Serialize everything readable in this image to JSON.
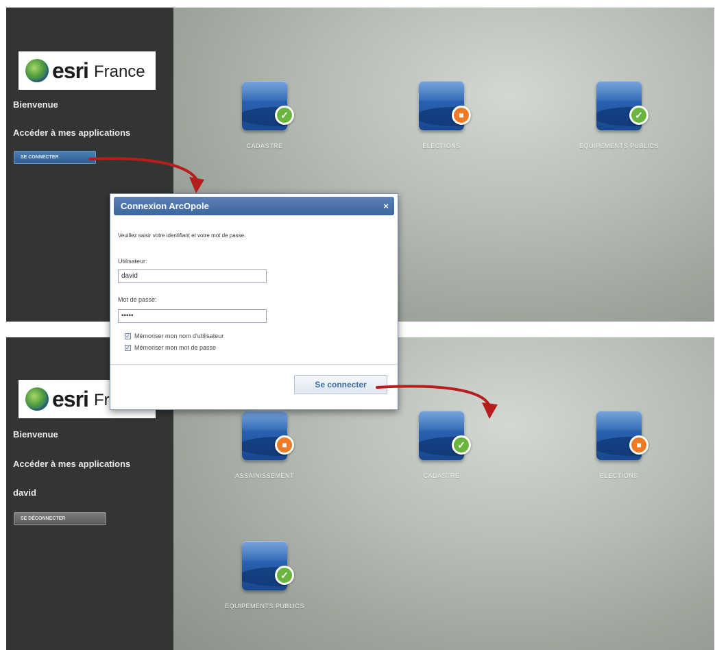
{
  "colors": {
    "sidebar": "#333533",
    "connect_button": "#2f5d93",
    "disconnect_button": "#5b5b5b",
    "dialog_title": "#3d659f",
    "badge_ok": "#6ab63c",
    "badge_lock": "#ef7a26",
    "arrow": "#b61d1d"
  },
  "top": {
    "logo": {
      "brand": "esri",
      "sub": "France"
    },
    "welcome": "Bienvenue",
    "apps_title": "Accéder à mes applications",
    "connect_button": "SE CONNECTER",
    "apps": [
      {
        "label": "CADASTRE",
        "status_icon": "check-icon"
      },
      {
        "label": "ELECTIONS",
        "status_icon": "lock-icon"
      },
      {
        "label": "EQUIPEMENTS PUBLICS",
        "status_icon": "check-icon"
      }
    ]
  },
  "dialog": {
    "title": "Connexion ArcOpole",
    "close": "×",
    "prompt": "Veuillez saisir votre identifiant et votre mot de passe.",
    "user_label": "Utilisateur:",
    "user_value": "david",
    "password_label": "Mot de passe:",
    "password_value": "•••••",
    "remember_user": "Mémoriser mon nom d'utilisateur",
    "remember_password": "Mémoriser mon mot de passe",
    "check_mark": "✓",
    "submit": "Se connecter"
  },
  "bottom": {
    "logo": {
      "brand": "esri",
      "sub": "France"
    },
    "welcome": "Bienvenue",
    "apps_title": "Accéder à mes applications",
    "username": "david",
    "disconnect_button": "SE DÉCONNECTER",
    "apps": [
      {
        "label": "ASSAINISSEMENT",
        "status_icon": "lock-icon"
      },
      {
        "label": "CADASTRE",
        "status_icon": "check-icon"
      },
      {
        "label": "ELECTIONS",
        "status_icon": "lock-icon"
      },
      {
        "label": "EQUIPEMENTS PUBLICS",
        "status_icon": "check-icon"
      }
    ]
  }
}
